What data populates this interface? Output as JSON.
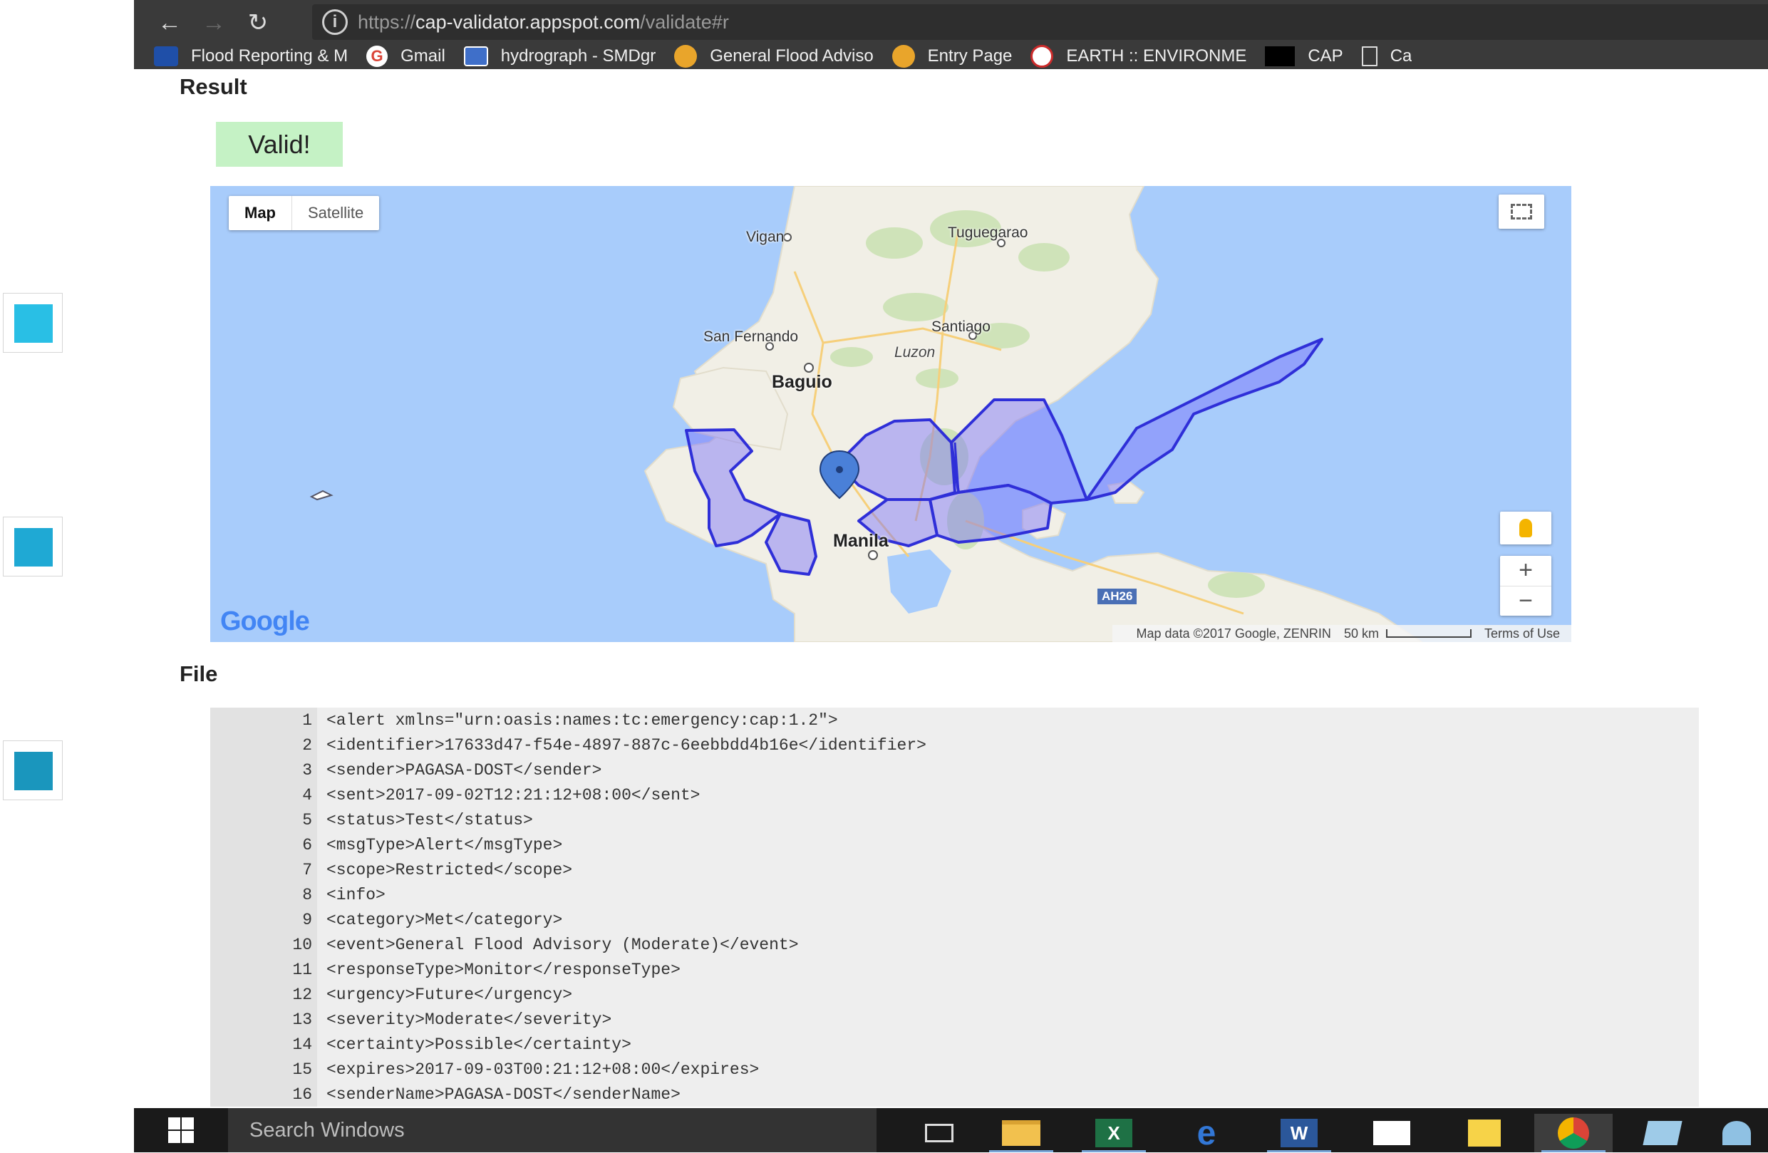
{
  "browser": {
    "url_scheme": "https://",
    "url_host": "cap-validator.appspot.com",
    "url_path": "/validate#r",
    "bookmarks": [
      {
        "label": "Flood Reporting & M",
        "icon": "flood-reporting-icon",
        "color": "#1f4fa8"
      },
      {
        "label": "Gmail",
        "icon": "google-icon",
        "color": "#ffffff"
      },
      {
        "label": "hydrograph - SMDgr",
        "icon": "hydrograph-icon",
        "color": "#3f6fc9"
      },
      {
        "label": "General Flood Adviso",
        "icon": "pagasa-icon",
        "color": "#e9a52b"
      },
      {
        "label": "Entry Page",
        "icon": "pagasa-icon",
        "color": "#e9a52b"
      },
      {
        "label": "EARTH :: ENVIRONME",
        "icon": "earth-environment-icon",
        "color": "#cc2b2b"
      },
      {
        "label": "CAP",
        "icon": "cap-icon",
        "color": "#000000"
      },
      {
        "label": "Ca",
        "icon": "page-icon",
        "color": "#3a3a3a"
      }
    ]
  },
  "side_tiles": [
    {
      "color": "#29bfe5"
    },
    {
      "color": "#1fa9d4"
    },
    {
      "color": "#1a96bd"
    }
  ],
  "result": {
    "title": "Result",
    "status": "Valid!"
  },
  "map": {
    "type_buttons": [
      "Map",
      "Satellite"
    ],
    "places": {
      "vigan": "Vigan",
      "tuguegarao": "Tuguegarao",
      "san_fernando": "San Fernando",
      "santiago": "Santiago",
      "luzon": "Luzon",
      "baguio": "Baguio",
      "manila": "Manila",
      "ah26": "AH26"
    },
    "logo": "Google",
    "attribution": "Map data ©2017 Google, ZENRIN",
    "scale": "50 km",
    "terms": "Terms of Use",
    "polygon_color": "#2f2fd8"
  },
  "file": {
    "title": "File",
    "lines": [
      {
        "n": "1",
        "text": "<alert xmlns=\"urn:oasis:names:tc:emergency:cap:1.2\">"
      },
      {
        "n": "2",
        "text": "<identifier>17633d47-f54e-4897-887c-6eebbdd4b16e</identifier>"
      },
      {
        "n": "3",
        "text": "<sender>PAGASA-DOST</sender>"
      },
      {
        "n": "4",
        "text": "<sent>2017-09-02T12:21:12+08:00</sent>"
      },
      {
        "n": "5",
        "text": "<status>Test</status>"
      },
      {
        "n": "6",
        "text": "<msgType>Alert</msgType>"
      },
      {
        "n": "7",
        "text": "<scope>Restricted</scope>"
      },
      {
        "n": "8",
        "text": "<info>"
      },
      {
        "n": "9",
        "text": "<category>Met</category>"
      },
      {
        "n": "10",
        "text": "<event>General Flood Advisory (Moderate)</event>"
      },
      {
        "n": "11",
        "text": "<responseType>Monitor</responseType>"
      },
      {
        "n": "12",
        "text": "<urgency>Future</urgency>"
      },
      {
        "n": "13",
        "text": "<severity>Moderate</severity>"
      },
      {
        "n": "14",
        "text": "<certainty>Possible</certainty>"
      },
      {
        "n": "15",
        "text": "<expires>2017-09-03T00:21:12+08:00</expires>"
      },
      {
        "n": "16",
        "text": "<senderName>PAGASA-DOST</senderName>"
      }
    ]
  },
  "taskbar": {
    "search_placeholder": "Search Windows"
  }
}
